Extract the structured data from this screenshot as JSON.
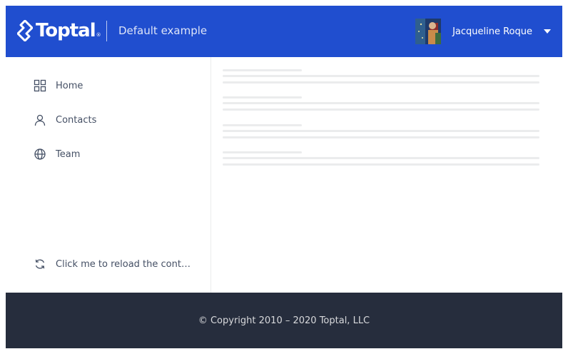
{
  "header": {
    "logo_text": "Toptal",
    "logo_mark": "®",
    "app_title": "Default example",
    "user": {
      "name": "Jacqueline Roque",
      "avatar_icon": "user-avatar"
    }
  },
  "sidebar": {
    "items": [
      {
        "label": "Home",
        "icon": "grid-icon"
      },
      {
        "label": "Contacts",
        "icon": "person-icon"
      },
      {
        "label": "Team",
        "icon": "globe-icon"
      }
    ],
    "reload": {
      "label": "Click me to reload the content",
      "icon": "refresh-icon"
    }
  },
  "footer": {
    "copyright": "© Copyright 2010 – 2020 Toptal, LLC"
  },
  "colors": {
    "brand": "#204ecf",
    "footer_bg": "#262d3d",
    "skeleton": "#ebeced"
  }
}
